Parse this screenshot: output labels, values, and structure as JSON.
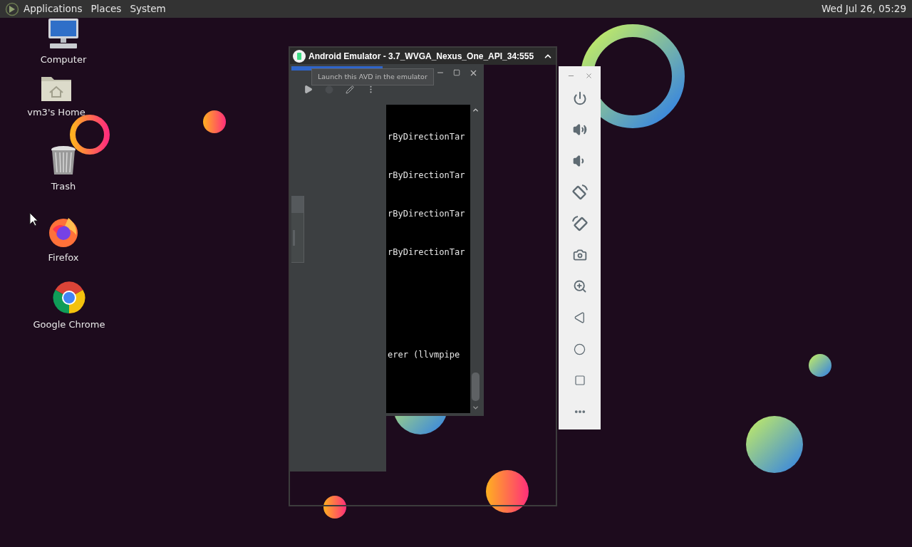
{
  "top_panel": {
    "menus": [
      "Applications",
      "Places",
      "System"
    ],
    "clock": "Wed Jul 26, 05:29"
  },
  "desktop_icons": [
    {
      "kind": "computer",
      "label": "Computer"
    },
    {
      "kind": "home",
      "label": "vm3's Home"
    },
    {
      "kind": "trash",
      "label": "Trash"
    },
    {
      "kind": "firefox",
      "label": "Firefox"
    },
    {
      "kind": "chrome",
      "label": "Google Chrome"
    }
  ],
  "emulator_window": {
    "title": "Android Emulator - 3.7_WVGA_Nexus_One_API_34:555"
  },
  "avd_manager": {
    "tooltip": "Launch this AVD in the emulator",
    "log_lines": [
      "rByDirectionTar",
      "rByDirectionTar",
      "rByDirectionTar",
      "rByDirectionTar",
      "erer (llvmpipe"
    ]
  }
}
